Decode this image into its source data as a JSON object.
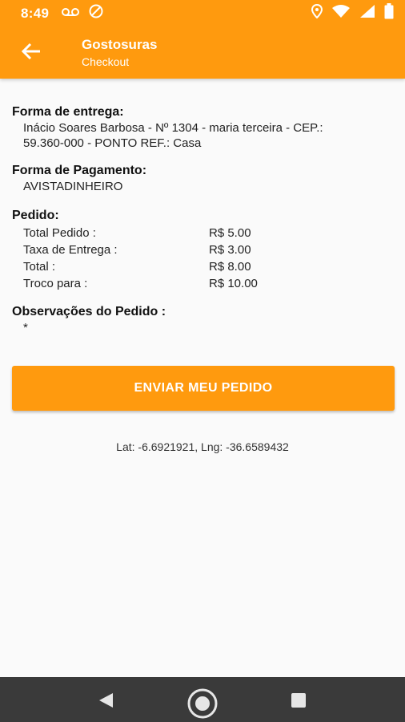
{
  "status_bar": {
    "time": "8:49",
    "icons_left": [
      "voicemail-icon",
      "vpn-icon"
    ],
    "icons_right": [
      "location-icon",
      "wifi-icon",
      "signal-icon",
      "battery-icon"
    ]
  },
  "toolbar": {
    "title": "Gostosuras",
    "subtitle": "Checkout",
    "back_icon": "arrow-back-icon"
  },
  "delivery": {
    "heading": "Forma de entrega:",
    "address_line1": "Inácio Soares Barbosa - Nº 1304 - maria terceira - CEP.:",
    "address_line2": "59.360-000 - PONTO REF.: Casa"
  },
  "payment": {
    "heading": "Forma de Pagamento:",
    "method": "AVISTADINHEIRO"
  },
  "order": {
    "heading": "Pedido:",
    "rows": [
      {
        "label": "Total Pedido :",
        "value": "R$ 5.00"
      },
      {
        "label": "Taxa de Entrega :",
        "value": "R$ 3.00"
      },
      {
        "label": "Total :",
        "value": "R$ 8.00"
      },
      {
        "label": "Troco para :",
        "value": "R$ 10.00"
      }
    ]
  },
  "notes": {
    "heading": "Observações do Pedido :",
    "value": "*"
  },
  "actions": {
    "send_label": "ENVIAR MEU PEDIDO"
  },
  "location": {
    "text": "Lat: -6.6921921, Lng: -36.6589432"
  },
  "colors": {
    "accent": "#ff9a0e",
    "navbar": "#3a3a3a"
  }
}
